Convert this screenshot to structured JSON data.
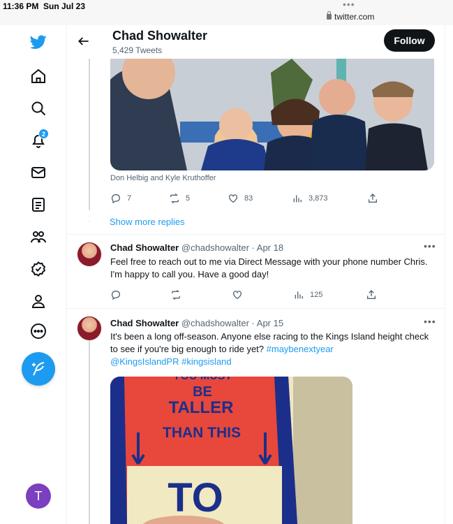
{
  "status": {
    "time": "11:36 PM",
    "date": "Sun Jul 23",
    "url": "twitter.com"
  },
  "sidebar": {
    "items": [
      {
        "name": "twitter-logo-icon"
      },
      {
        "name": "home-icon"
      },
      {
        "name": "search-icon"
      },
      {
        "name": "notifications-icon",
        "badge": "2"
      },
      {
        "name": "messages-icon"
      },
      {
        "name": "lists-icon"
      },
      {
        "name": "communities-icon"
      },
      {
        "name": "verified-icon"
      },
      {
        "name": "profile-icon"
      },
      {
        "name": "more-icon"
      }
    ],
    "compose_icon": "feather-plus-icon",
    "account_initial": "T"
  },
  "header": {
    "name": "Chad Showalter",
    "tweet_count": "5,429 Tweets",
    "follow_label": "Follow"
  },
  "reply1": {
    "caption": "Don Helbig and Kyle Kruthoffer",
    "replies": "7",
    "retweets": "5",
    "likes": "83",
    "views": "3,873",
    "show_more": "Show more replies"
  },
  "tweet2": {
    "name": "Chad Showalter",
    "handle": "@chadshowalter",
    "sep": "·",
    "date": "Apr 18",
    "text": "Feel free to reach out to me via Direct Message with your phone number Chris. I'm happy to call you.  Have a good day!",
    "views": "125"
  },
  "tweet3": {
    "name": "Chad Showalter",
    "handle": "@chadshowalter",
    "sep": "·",
    "date": "Apr 15",
    "text": "It's been a long off-season. Anyone else racing to the Kings Island height check to see if you're big enough to ride yet? ",
    "hashtag1": "#maybenextyear",
    "mention": "@KingsIslandPR",
    "hashtag2": "#kingsisland",
    "sign_line1": "YOU MUST",
    "sign_line2": "BE",
    "sign_line3": "TALLER",
    "sign_line4": "THAN THIS",
    "sign_line5": "TO"
  },
  "colors": {
    "accent": "#1d9bf0",
    "text": "#0f1419",
    "muted": "#536471"
  }
}
